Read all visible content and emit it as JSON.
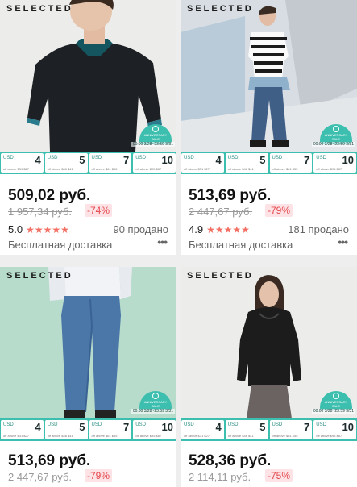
{
  "products": [
    {
      "brand": "SELECTED",
      "price": "509,02 руб.",
      "old_price": "1 957,34 руб.",
      "discount": "-74%",
      "rating": "5.0",
      "stars": "★★★★★",
      "sold": "90 продано",
      "shipping": "Бесплатная доставка",
      "more": "•••"
    },
    {
      "brand": "SELECTED",
      "price": "513,69 руб.",
      "old_price": "2 447,67 руб.",
      "discount": "-79%",
      "rating": "4.9",
      "stars": "★★★★★",
      "sold": "181 продано",
      "shipping": "Бесплатная доставка",
      "more": "•••"
    },
    {
      "brand": "SELECTED",
      "price": "513,69 руб.",
      "old_price": "2 447,67 руб.",
      "discount": "-79%"
    },
    {
      "brand": "SELECTED",
      "price": "528,36 руб.",
      "old_price": "2 114,11 руб.",
      "discount": "-75%"
    }
  ],
  "coupons": [
    {
      "currency": "USD",
      "amount": "4",
      "condition": "off above $31 $27"
    },
    {
      "currency": "USD",
      "amount": "5",
      "condition": "off above $46 $41"
    },
    {
      "currency": "USD",
      "amount": "7",
      "condition": "off above $61 $55"
    },
    {
      "currency": "USD",
      "amount": "10",
      "condition": "off above $95 $87"
    }
  ],
  "seal": {
    "line1": "ANNIVERSARY",
    "line2": "SALE"
  },
  "timer": "00:00 3/28~23:59 3/31",
  "colors": {
    "teal": "#3cbfae",
    "star": "#f36e63",
    "discount_text": "#e5484d",
    "discount_bg": "#fde3e6"
  }
}
